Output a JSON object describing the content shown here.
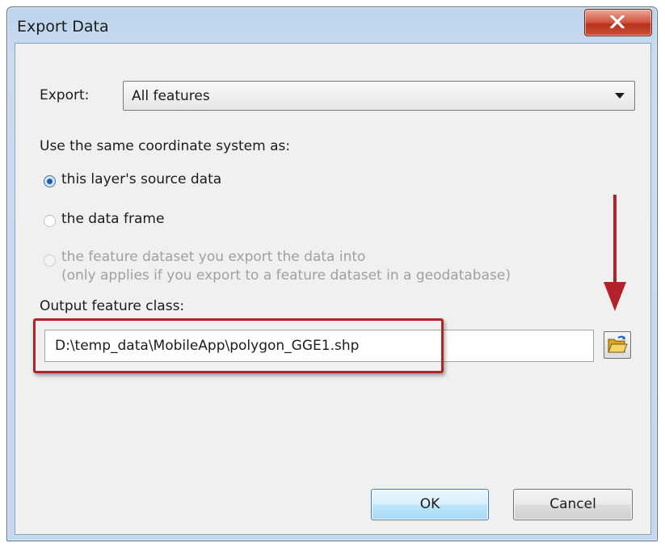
{
  "window": {
    "title": "Export Data",
    "close_icon": "close-x-icon"
  },
  "export": {
    "label": "Export:",
    "selected": "All features"
  },
  "coordinate_system": {
    "heading": "Use the same coordinate system as:",
    "options": [
      {
        "label": "this layer's source data",
        "state": "checked"
      },
      {
        "label": "the data frame",
        "state": "unchecked"
      },
      {
        "label": "the feature dataset you export the data into",
        "sublabel": "(only applies if you export to a feature dataset in a geodatabase)",
        "state": "disabled"
      }
    ]
  },
  "output": {
    "label": "Output feature class:",
    "value": "D:\\temp_data\\MobileApp\\polygon_GGE1.shp",
    "browse_icon": "open-folder-icon"
  },
  "buttons": {
    "ok": "OK",
    "cancel": "Cancel"
  },
  "annotations": {
    "color": "#b3222b",
    "arrow_icon": "red-down-arrow",
    "highlight": "red-rectangle"
  }
}
